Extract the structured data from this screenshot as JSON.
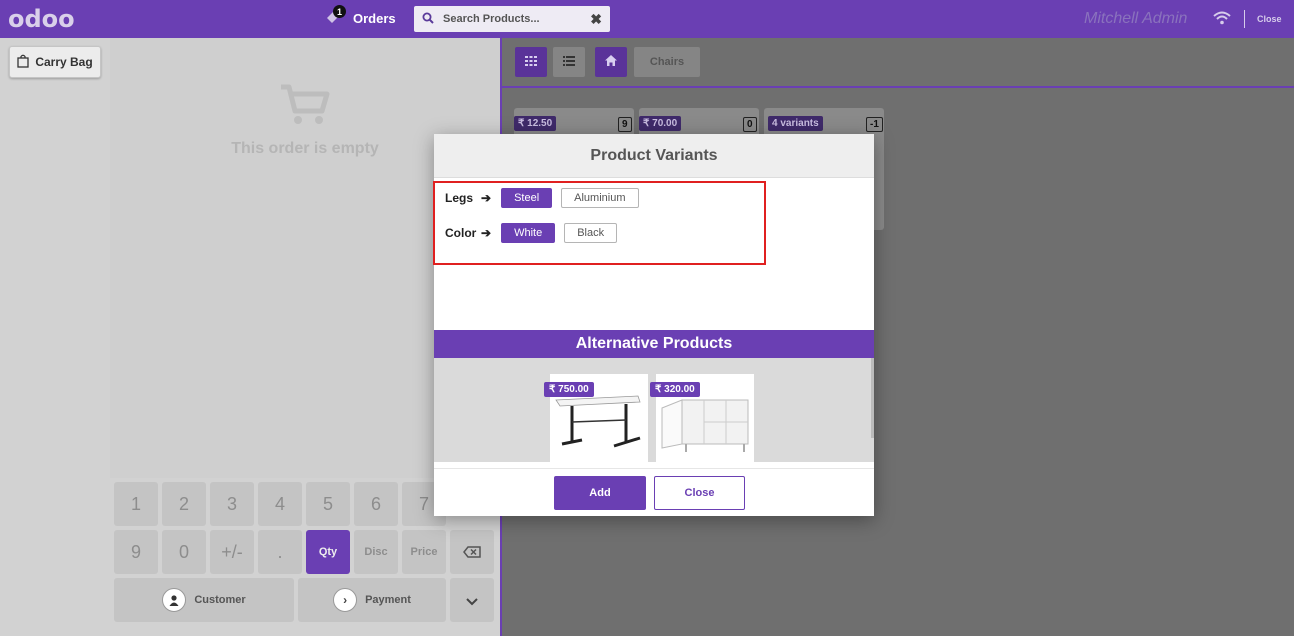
{
  "header": {
    "logo": "odoo",
    "orders_label": "Orders",
    "orders_badge": "1",
    "search_placeholder": "Search Products...",
    "user_name": "Mitchell Admin",
    "close_label": "Close"
  },
  "left": {
    "carry_bag_label": "Carry Bag",
    "empty_text": "This order is empty"
  },
  "numpad": {
    "row1": [
      "1",
      "2",
      "3",
      "4",
      "5",
      "6",
      "7"
    ],
    "row2": [
      "9",
      "0",
      "+/-",
      ".",
      "Qty",
      "Disc",
      "Price"
    ],
    "customer_label": "Customer",
    "payment_label": "Payment"
  },
  "products_toolbar": {
    "breadcrumb": "Chairs"
  },
  "products": [
    {
      "price": "₹ 12.50",
      "count": "9"
    },
    {
      "price": "₹ 70.00",
      "count": "0"
    },
    {
      "price": "4 variants",
      "count": "-1"
    }
  ],
  "modal": {
    "title": "Product Variants",
    "attributes": [
      {
        "label": "Legs",
        "options": [
          "Steel",
          "Aluminium"
        ],
        "selected": "Steel"
      },
      {
        "label": "Color",
        "options": [
          "White",
          "Black"
        ],
        "selected": "White"
      }
    ],
    "alt_title": "Alternative Products",
    "alternatives": [
      {
        "price": "₹ 750.00"
      },
      {
        "price": "₹ 320.00"
      }
    ],
    "add_label": "Add",
    "close_label": "Close"
  },
  "colors": {
    "brand": "#6a3fb3",
    "highlight_box": "#e02020"
  }
}
